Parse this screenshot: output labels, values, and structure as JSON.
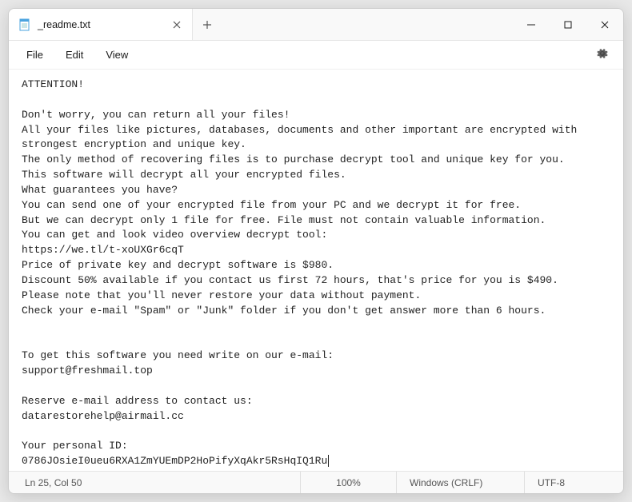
{
  "titlebar": {
    "tab_title": "_readme.txt"
  },
  "menubar": {
    "file": "File",
    "edit": "Edit",
    "view": "View"
  },
  "content": {
    "lines": [
      "ATTENTION!",
      "",
      "Don't worry, you can return all your files!",
      "All your files like pictures, databases, documents and other important are encrypted with strongest encryption and unique key.",
      "The only method of recovering files is to purchase decrypt tool and unique key for you.",
      "This software will decrypt all your encrypted files.",
      "What guarantees you have?",
      "You can send one of your encrypted file from your PC and we decrypt it for free.",
      "But we can decrypt only 1 file for free. File must not contain valuable information.",
      "You can get and look video overview decrypt tool:",
      "https://we.tl/t-xoUXGr6cqT",
      "Price of private key and decrypt software is $980.",
      "Discount 50% available if you contact us first 72 hours, that's price for you is $490.",
      "Please note that you'll never restore your data without payment.",
      "Check your e-mail \"Spam\" or \"Junk\" folder if you don't get answer more than 6 hours.",
      "",
      "",
      "To get this software you need write on our e-mail:",
      "support@freshmail.top",
      "",
      "Reserve e-mail address to contact us:",
      "datarestorehelp@airmail.cc",
      "",
      "Your personal ID:",
      "0786JOsieI0ueu6RXA1ZmYUEmDP2HoPifyXqAkr5RsHqIQ1Ru"
    ]
  },
  "statusbar": {
    "position": "Ln 25, Col 50",
    "zoom": "100%",
    "eol": "Windows (CRLF)",
    "encoding": "UTF-8"
  }
}
